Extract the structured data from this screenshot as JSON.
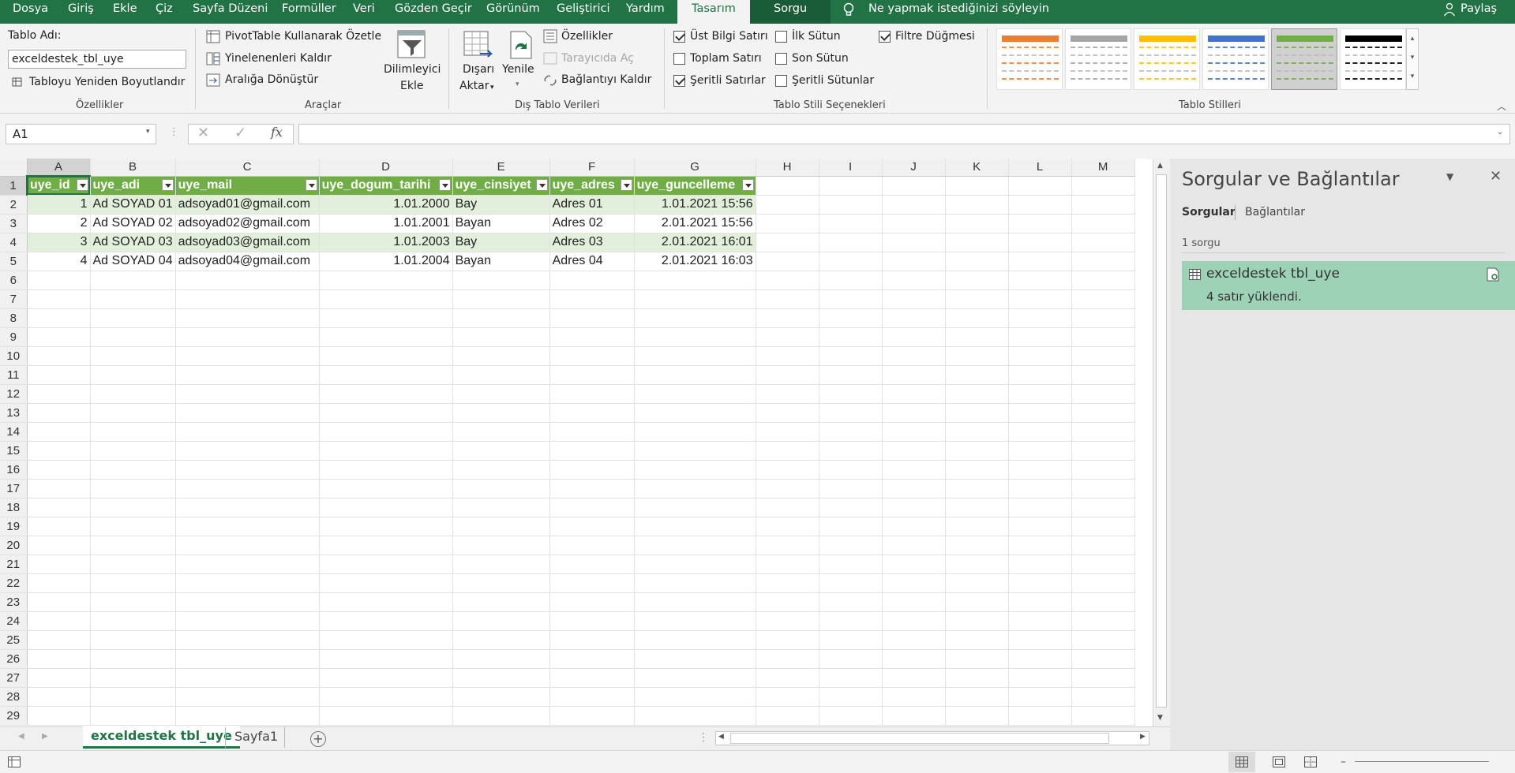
{
  "tabs": [
    "Dosya",
    "Giriş",
    "Ekle",
    "Çiz",
    "Sayfa Düzeni",
    "Formüller",
    "Veri",
    "Gözden Geçir",
    "Görünüm",
    "Geliştirici",
    "Yardım",
    "Tasarım",
    "Sorgu"
  ],
  "tell_me": "Ne yapmak istediğinizi söyleyin",
  "share": "Paylaş",
  "ribbon": {
    "tablo_adi_label": "Tablo Adı:",
    "tablo_adi_value": "exceldestek_tbl_uye",
    "resize": "Tabloyu Yeniden Boyutlandır",
    "grp_ozellikler": "Özellikler",
    "pivot": "PivotTable Kullanarak Özetle",
    "remove_dup": "Yinelenenleri Kaldır",
    "convert": "Aralığa Dönüştür",
    "slicer_1": "Dilimleyici",
    "slicer_2": "Ekle",
    "grp_araclar": "Araçlar",
    "export_1": "Dışarı",
    "export_2": "Aktar",
    "refresh": "Yenile",
    "properties": "Özellikler",
    "open_browser": "Tarayıcıda Aç",
    "unlink": "Bağlantıyı Kaldır",
    "grp_dis": "Dış Tablo Verileri",
    "opt_header": "Üst Bilgi Satırı",
    "opt_total": "Toplam Satırı",
    "opt_banded_rows": "Şeritli Satırlar",
    "opt_first_col": "İlk Sütun",
    "opt_last_col": "Son Sütun",
    "opt_banded_cols": "Şeritli Sütunlar",
    "opt_filter": "Filtre Düğmesi",
    "grp_options": "Tablo Stili Seçenekleri",
    "grp_styles": "Tablo Stilleri",
    "style_colors": [
      "#ed7d31",
      "#a5a5a5",
      "#ffc000",
      "#4472c4",
      "#70ad47",
      "#000000"
    ]
  },
  "formula": {
    "name_box": "A1",
    "fx": "fx",
    "value": ""
  },
  "columns": [
    "A",
    "B",
    "C",
    "D",
    "E",
    "F",
    "G",
    "H",
    "I",
    "J",
    "K",
    "L",
    "M"
  ],
  "table_headers": [
    "uye_id",
    "uye_adi",
    "uye_mail",
    "uye_dogum_tarihi",
    "uye_cinsiyet",
    "uye_adres",
    "uye_guncelleme"
  ],
  "rows": [
    [
      "1",
      "Ad SOYAD 01",
      "adsoyad01@gmail.com",
      "1.01.2000",
      "Bay",
      "Adres 01",
      "1.01.2021 15:56"
    ],
    [
      "2",
      "Ad SOYAD 02",
      "adsoyad02@gmail.com",
      "1.01.2001",
      "Bayan",
      "Adres 02",
      "2.01.2021 15:56"
    ],
    [
      "3",
      "Ad SOYAD 03",
      "adsoyad03@gmail.com",
      "1.01.2003",
      "Bay",
      "Adres 03",
      "2.01.2021 16:01"
    ],
    [
      "4",
      "Ad SOYAD 04",
      "adsoyad04@gmail.com",
      "1.01.2004",
      "Bayan",
      "Adres 04",
      "2.01.2021 16:03"
    ]
  ],
  "row_count": 29,
  "pane": {
    "title": "Sorgular ve Bağlantılar",
    "tab_queries": "Sorgular",
    "tab_connections": "Bağlantılar",
    "count": "1 sorgu",
    "query_name": "exceldestek tbl_uye",
    "query_status": "4 satır yüklendi."
  },
  "sheets": [
    "exceldestek tbl_uye",
    "Sayfa1"
  ],
  "colors": {
    "accent": "#217346",
    "table_header": "#70ad47",
    "band": "#e2efda",
    "query_bg": "#9ed2b6"
  }
}
